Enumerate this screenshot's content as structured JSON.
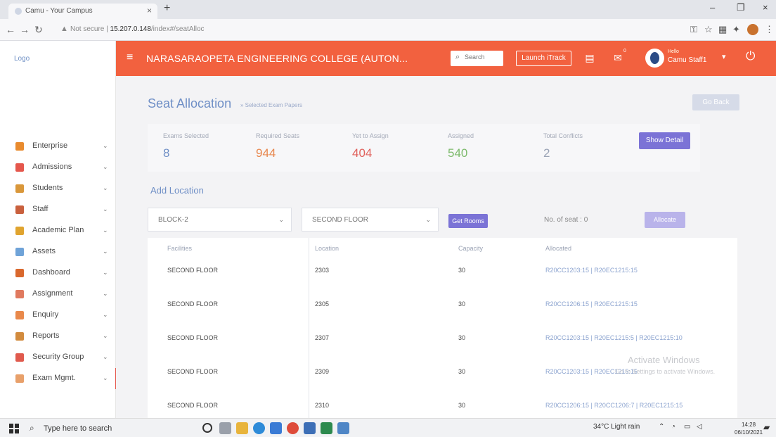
{
  "browser": {
    "tab_title": "Camu - Your Campus",
    "tab_close": "×",
    "new_tab": "+",
    "not_secure": "Not secure",
    "url_host": "15.207.0.148",
    "url_path": "/index#/seatAlloc",
    "window_controls": [
      "–",
      "❐",
      "×"
    ]
  },
  "sidebar": {
    "logo_alt": "Logo",
    "items": [
      {
        "label": "Enterprise",
        "icon": "enterprise-icon",
        "color": "#e98b2e"
      },
      {
        "label": "Admissions",
        "icon": "admissions-icon",
        "color": "#e5574c"
      },
      {
        "label": "Students",
        "icon": "students-icon",
        "color": "#d9973a"
      },
      {
        "label": "Staff",
        "icon": "staff-icon",
        "color": "#c9603d"
      },
      {
        "label": "Academic Plan",
        "icon": "academic-plan-icon",
        "color": "#e0a42f"
      },
      {
        "label": "Assets",
        "icon": "assets-icon",
        "color": "#6fa3d8"
      },
      {
        "label": "Dashboard",
        "icon": "dashboard-icon",
        "color": "#d9682d"
      },
      {
        "label": "Assignment",
        "icon": "assignment-icon",
        "color": "#e07a5f"
      },
      {
        "label": "Enquiry",
        "icon": "enquiry-icon",
        "color": "#e9894b"
      },
      {
        "label": "Reports",
        "icon": "reports-icon",
        "color": "#d28b3e"
      },
      {
        "label": "Security Group",
        "icon": "security-group-icon",
        "color": "#e05a4d"
      },
      {
        "label": "Exam Mgmt.",
        "icon": "exam-mgmt-icon",
        "color": "#e8a06a"
      }
    ]
  },
  "topbar": {
    "college": "NARASARAOPETA ENGINEERING COLLEGE (AUTON...",
    "search_placeholder": "Search",
    "launch": "Launch iTrack",
    "mail_badge": "0",
    "hello": "Hello",
    "user": "Camu Staff1",
    "color": "#f2613f"
  },
  "page": {
    "title": "Seat Allocation",
    "breadcrumb": "» Selected Exam Papers",
    "back": "Go Back",
    "stats": [
      {
        "label": "Exams Selected",
        "value": "8",
        "color": "#6f8fc6"
      },
      {
        "label": "Required Seats",
        "value": "944",
        "color": "#e8884f"
      },
      {
        "label": "Yet to Assign",
        "value": "404",
        "color": "#e0615c"
      },
      {
        "label": "Assigned",
        "value": "540",
        "color": "#7dba6c"
      },
      {
        "label": "Total Conflicts",
        "value": "2",
        "color": "#9aa3b5"
      }
    ],
    "show_detail": "Show Detail",
    "add_location": "Add Location",
    "block_select": "BLOCK-2",
    "floor_select": "SECOND FLOOR",
    "get_rooms": "Get Rooms",
    "seat_count": "No. of seat : 0",
    "allocate": "Allocate",
    "table": {
      "headers": [
        "Facilities",
        "Location",
        "Capacity",
        "Allocated"
      ],
      "rows": [
        {
          "facility": "SECOND FLOOR",
          "location": "2303",
          "capacity": "30",
          "allocated": "R20CC1203:15 | R20EC1215:15"
        },
        {
          "facility": "SECOND FLOOR",
          "location": "2305",
          "capacity": "30",
          "allocated": "R20CC1206:15 | R20EC1215:15"
        },
        {
          "facility": "SECOND FLOOR",
          "location": "2307",
          "capacity": "30",
          "allocated": "R20CC1203:15 | R20EC1215:5 | R20EC1215:10"
        },
        {
          "facility": "SECOND FLOOR",
          "location": "2309",
          "capacity": "30",
          "allocated": "R20CC1203:15 | R20EC1215:15"
        },
        {
          "facility": "SECOND FLOOR",
          "location": "2310",
          "capacity": "30",
          "allocated": "R20CC1206:15 | R20CC1206:7 | R20EC1215:15"
        }
      ]
    },
    "watermark": [
      "Activate Windows",
      "Go to Settings to activate Windows."
    ]
  },
  "taskbar": {
    "search": "Type here to search",
    "weather": "34°C  Light rain",
    "time": "14:28",
    "date": "06/10/2021"
  }
}
